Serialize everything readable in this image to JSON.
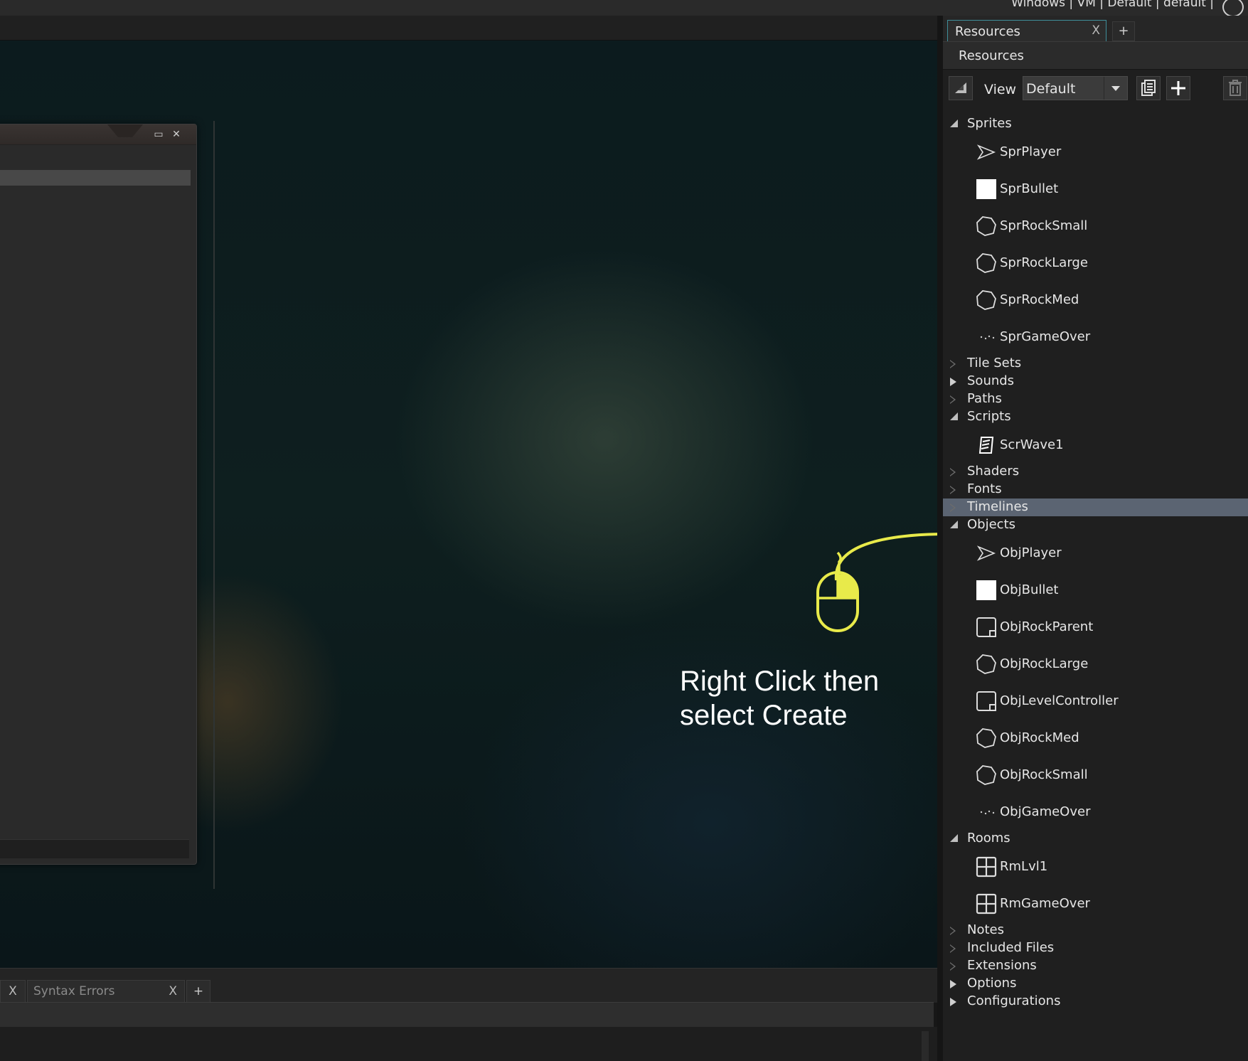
{
  "topbar": {
    "target_text": "Windows | VM | Default | default |"
  },
  "resources_panel": {
    "tab_label": "Resources",
    "tab_close": "X",
    "tab_add": "+",
    "header": "Resources",
    "toolbar": {
      "view_label": "View",
      "view_value": "Default"
    },
    "tree": [
      {
        "type": "folder",
        "label": "Sprites",
        "state": "open"
      },
      {
        "type": "item",
        "label": "SprPlayer",
        "icon": "ship-icon"
      },
      {
        "type": "item",
        "label": "SprBullet",
        "icon": "white-square-icon"
      },
      {
        "type": "item",
        "label": "SprRockSmall",
        "icon": "rock-icon"
      },
      {
        "type": "item",
        "label": "SprRockLarge",
        "icon": "rock-icon"
      },
      {
        "type": "item",
        "label": "SprRockMed",
        "icon": "rock-icon"
      },
      {
        "type": "item",
        "label": "SprGameOver",
        "icon": "dots-icon"
      },
      {
        "type": "folder",
        "label": "Tile Sets",
        "state": "closed-hollow"
      },
      {
        "type": "folder",
        "label": "Sounds",
        "state": "closed-filled"
      },
      {
        "type": "folder",
        "label": "Paths",
        "state": "closed-hollow"
      },
      {
        "type": "folder",
        "label": "Scripts",
        "state": "open"
      },
      {
        "type": "item",
        "label": "ScrWave1",
        "icon": "script-icon"
      },
      {
        "type": "folder",
        "label": "Shaders",
        "state": "closed-hollow"
      },
      {
        "type": "folder",
        "label": "Fonts",
        "state": "closed-hollow"
      },
      {
        "type": "folder",
        "label": "Timelines",
        "state": "closed-hollow",
        "selected": true
      },
      {
        "type": "folder",
        "label": "Objects",
        "state": "open"
      },
      {
        "type": "item",
        "label": "ObjPlayer",
        "icon": "ship-icon"
      },
      {
        "type": "item",
        "label": "ObjBullet",
        "icon": "white-square-icon"
      },
      {
        "type": "item",
        "label": "ObjRockParent",
        "icon": "object-icon"
      },
      {
        "type": "item",
        "label": "ObjRockLarge",
        "icon": "rock-icon"
      },
      {
        "type": "item",
        "label": "ObjLevelController",
        "icon": "object-icon"
      },
      {
        "type": "item",
        "label": "ObjRockMed",
        "icon": "rock-icon"
      },
      {
        "type": "item",
        "label": "ObjRockSmall",
        "icon": "rock-icon"
      },
      {
        "type": "item",
        "label": "ObjGameOver",
        "icon": "dots-icon"
      },
      {
        "type": "folder",
        "label": "Rooms",
        "state": "open"
      },
      {
        "type": "item",
        "label": "RmLvl1",
        "icon": "room-icon"
      },
      {
        "type": "item",
        "label": "RmGameOver",
        "icon": "room-icon"
      },
      {
        "type": "folder",
        "label": "Notes",
        "state": "closed-hollow"
      },
      {
        "type": "folder",
        "label": "Included Files",
        "state": "closed-hollow"
      },
      {
        "type": "folder",
        "label": "Extensions",
        "state": "closed-hollow"
      },
      {
        "type": "folder",
        "label": "Options",
        "state": "closed-filled"
      },
      {
        "type": "folder",
        "label": "Configurations",
        "state": "closed-filled"
      }
    ]
  },
  "annotation": {
    "text": "Right Click then\nselect Create",
    "color": "#e8ea4a"
  },
  "bottom_panel": {
    "tab_close_first": "X",
    "tabs": [
      {
        "label": "Syntax Errors",
        "close": "X"
      }
    ],
    "add_label": "+"
  },
  "workspace_window": {
    "maximize": "▭",
    "close": "✕"
  }
}
